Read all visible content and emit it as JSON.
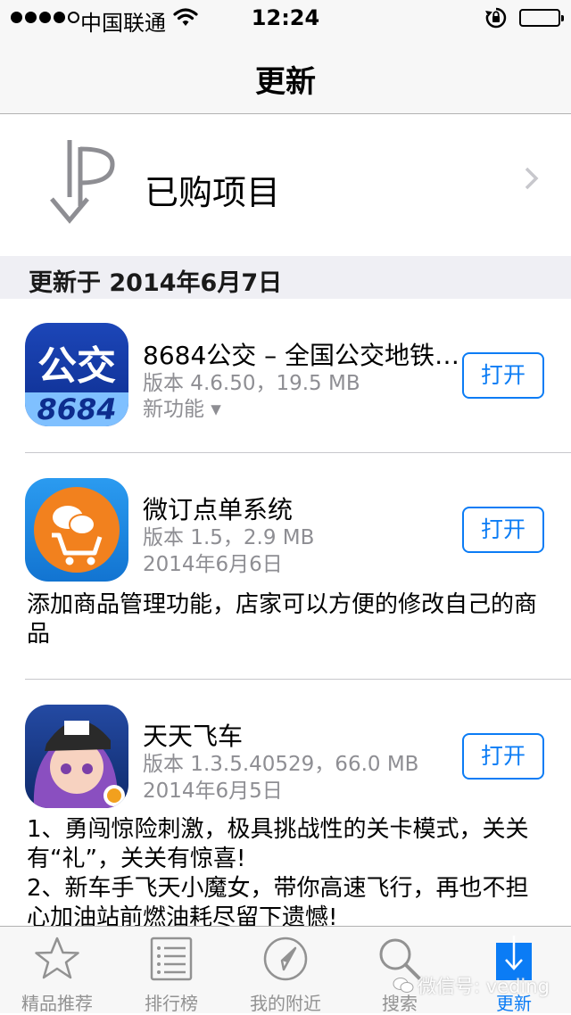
{
  "status_bar": {
    "carrier": "中国联通",
    "time": "12:24",
    "signal_strength": 4,
    "icons": [
      "wifi-icon",
      "orientation-lock-icon",
      "battery-icon"
    ]
  },
  "nav": {
    "title": "更新"
  },
  "purchased": {
    "label": "已购项目",
    "icon": "purchased-icon"
  },
  "section": {
    "title": "更新于 2014年6月7日"
  },
  "apps": [
    {
      "name": "8684公交 – 全国公交地铁…",
      "version": "版本 4.6.50，19.5 MB",
      "extra": "新功能 ▾",
      "button": "打开",
      "icon_text_top": "公交",
      "icon_text_bottom": "8684"
    },
    {
      "name": "微订点单系统",
      "version": "版本 1.5，2.9 MB",
      "date": "2014年6月6日",
      "button": "打开",
      "description": "添加商品管理功能，店家可以方便的修改自己的商品"
    },
    {
      "name": "天天飞车",
      "version": "版本 1.3.5.40529，66.0 MB",
      "date": "2014年6月5日",
      "button": "打开",
      "description_line1": "1、勇闯惊险刺激，极具挑战性的关卡模式，关关有“礼”，关关有惊喜!",
      "description_line2": "2、新车手飞天小魔女，带你高速飞行，再也不担心加油站前燃油耗尽留下遗憾!"
    }
  ],
  "tabs": [
    {
      "label": "精品推荐",
      "icon": "star-icon",
      "active": false
    },
    {
      "label": "排行榜",
      "icon": "list-icon",
      "active": false
    },
    {
      "label": "我的附近",
      "icon": "location-icon",
      "active": false
    },
    {
      "label": "搜索",
      "icon": "search-icon",
      "active": false
    },
    {
      "label": "更新",
      "icon": "updates-icon",
      "active": true
    }
  ],
  "watermark": "微信号: veding",
  "colors": {
    "accent": "#0b7cf5",
    "secondary_text": "#8e8e93",
    "bar_bg": "#f7f7f7",
    "section_bg": "#efeff4"
  }
}
